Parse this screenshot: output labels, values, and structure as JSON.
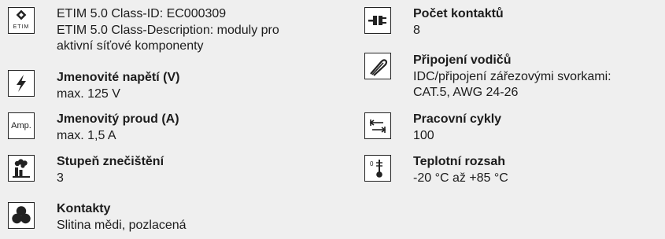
{
  "left_column": {
    "etim": {
      "icon_label": "ETIM",
      "line1": "ETIM 5.0 Class-ID: EC000309",
      "line2": "ETIM 5.0 Class-Description: moduly pro",
      "line3": "aktivní síťové komponenty"
    },
    "voltage": {
      "label": "Jmenovité napětí (V)",
      "value": "max. 125 V"
    },
    "current": {
      "icon_label": "Amp.",
      "label": "Jmenovitý proud (A)",
      "value": "max. 1,5 A"
    },
    "pollution": {
      "label": "Stupeň znečištění",
      "value": "3"
    },
    "contacts": {
      "label": "Kontakty",
      "value": "Slitina mědi, pozlacená"
    }
  },
  "right_column": {
    "contact_count": {
      "label": "Počet kontaktů",
      "value": "8"
    },
    "wire_connection": {
      "label": "Připojení vodičů",
      "line1": "IDC/připojení zářezovými svorkami:",
      "line2": "CAT.5, AWG 24-26"
    },
    "cycles": {
      "label": "Pracovní cykly",
      "value": "100"
    },
    "temperature": {
      "label": "Teplotní rozsah",
      "value": "-20 °C až +85 °C"
    }
  }
}
